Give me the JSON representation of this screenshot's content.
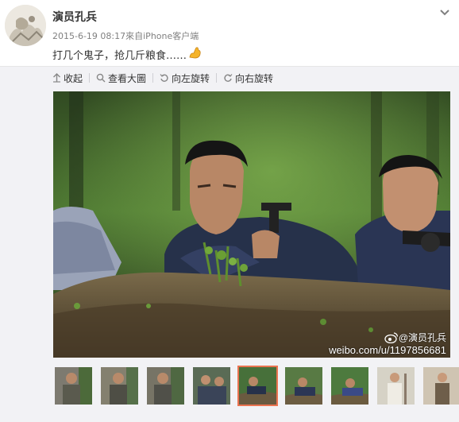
{
  "post": {
    "author": "演员孔兵",
    "meta": "2015-6-19 08:17來自iPhone客户端",
    "text": "打几个鬼子，抢几斤粮食……"
  },
  "toolbar": {
    "collapse": "收起",
    "view_large": "查看大圖",
    "rotate_left": "向左旋转",
    "rotate_right": "向右旋转"
  },
  "watermark": {
    "name": "@演员孔兵",
    "url": "weibo.com/u/1197856681"
  },
  "thumbnails": {
    "count": 9,
    "active_index": 4
  },
  "colors": {
    "accent": "#eb7350",
    "link": "#333333"
  }
}
